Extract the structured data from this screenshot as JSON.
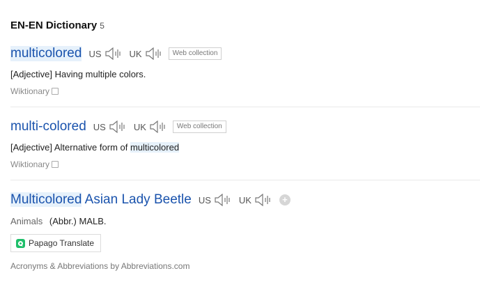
{
  "section": {
    "title": "EN-EN Dictionary",
    "count": "5"
  },
  "entries": [
    {
      "headword": "multicolored",
      "us_label": "US",
      "uk_label": "UK",
      "badge": "Web collection",
      "def_prefix": "[Adjective] Having multiple colors.",
      "source": "Wiktionary"
    },
    {
      "headword": "multi-colored",
      "us_label": "US",
      "uk_label": "UK",
      "badge": "Web collection",
      "def_prefix": "[Adjective] Alternative form of ",
      "def_link": "multicolored",
      "source": "Wiktionary"
    },
    {
      "headword_hl": "Multicolored",
      "headword_rest": " Asian Lady Beetle",
      "us_label": "US",
      "uk_label": "UK",
      "add_label": "+",
      "category": "Animals",
      "meaning": "(Abbr.) MALB.",
      "translate_button": "Papago Translate",
      "credit": "Acronyms & Abbreviations by Abbreviations.com"
    }
  ],
  "icons": {
    "speaker": "speaker-icon",
    "external": "external-link-icon",
    "papago": "papago-icon"
  },
  "colors": {
    "headword": "#1a53ad",
    "highlight": "#e6f1fb",
    "papago_green": "#1fbf6a"
  }
}
